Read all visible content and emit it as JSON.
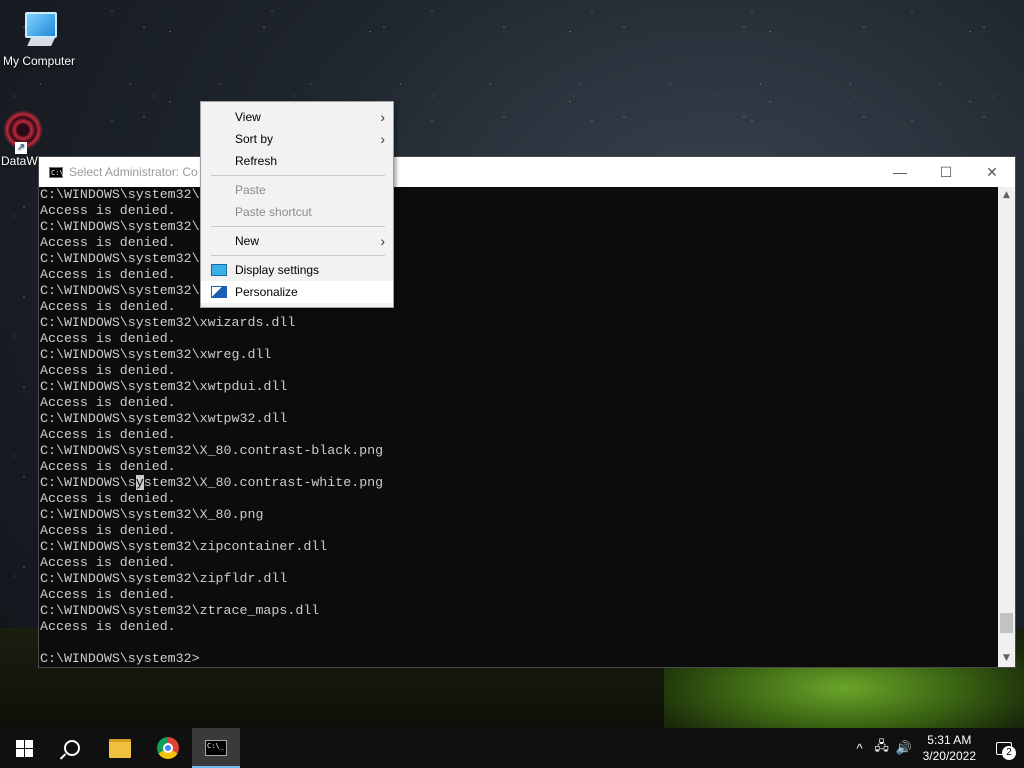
{
  "desktop": {
    "icons": [
      {
        "label": "My Computer"
      },
      {
        "label": "DataW"
      }
    ]
  },
  "cmd_window": {
    "title": "Select Administrator: Co",
    "minimize_glyph": "—",
    "maximize_glyph": "☐",
    "close_glyph": "✕",
    "lines": [
      "C:\\WINDOWS\\system32\\",
      "Access is denied.",
      "C:\\WINDOWS\\system32\\",
      "Access is denied.",
      "C:\\WINDOWS\\system32\\",
      "Access is denied.",
      "C:\\WINDOWS\\system32\\",
      "Access is denied.",
      "C:\\WINDOWS\\system32\\xwizards.dll",
      "Access is denied.",
      "C:\\WINDOWS\\system32\\xwreg.dll",
      "Access is denied.",
      "C:\\WINDOWS\\system32\\xwtpdui.dll",
      "Access is denied.",
      "C:\\WINDOWS\\system32\\xwtpw32.dll",
      "Access is denied.",
      "C:\\WINDOWS\\system32\\X_80.contrast-black.png",
      "Access is denied.",
      "C:\\WINDOWS\\system32\\X_80.contrast-white.png",
      "Access is denied.",
      "C:\\WINDOWS\\system32\\X_80.png",
      "Access is denied.",
      "C:\\WINDOWS\\system32\\zipcontainer.dll",
      "Access is denied.",
      "C:\\WINDOWS\\system32\\zipfldr.dll",
      "Access is denied.",
      "C:\\WINDOWS\\system32\\ztrace_maps.dll",
      "Access is denied.",
      "",
      "C:\\WINDOWS\\system32>"
    ],
    "selection_line_index": 18,
    "selection_line": {
      "before": "C:\\WINDOWS\\s",
      "selected": "y",
      "after": "stem32\\X_80.contrast-white.png"
    }
  },
  "context_menu": {
    "view": "View",
    "sort_by": "Sort by",
    "refresh": "Refresh",
    "paste": "Paste",
    "paste_shortcut": "Paste shortcut",
    "new": "New",
    "display_settings": "Display settings",
    "personalize": "Personalize",
    "submenu_glyph": "›"
  },
  "taskbar": {
    "clock_time": "5:31 AM",
    "clock_date": "3/20/2022",
    "notification_count": "2",
    "tray_chevron": "^",
    "tray_network": "🖧",
    "tray_volume": "🔊"
  },
  "colors": {
    "cmd_background": "#0c0c0c",
    "cmd_text": "#cccccc",
    "taskbar": "#101010",
    "accent": "#76b9ed"
  }
}
